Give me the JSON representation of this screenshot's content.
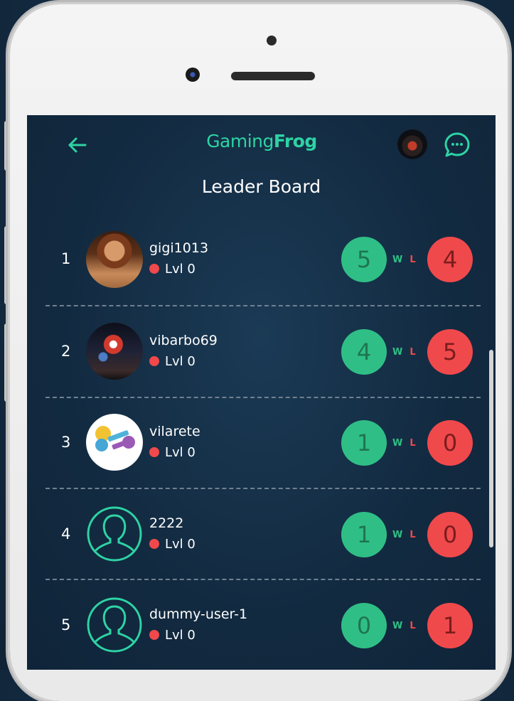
{
  "app": {
    "brand_light": "Gaming",
    "brand_bold": "Frog",
    "title": "Leader Board"
  },
  "icons": {
    "back": "back-arrow-icon",
    "chat": "chat-bubble-icon",
    "default_avatar": "user-outline-icon"
  },
  "colors": {
    "accent": "#2ed3a4",
    "win": "#2fbf86",
    "loss": "#f0494c",
    "background": "#132a40"
  },
  "labels": {
    "win": "W",
    "loss": "L"
  },
  "players": [
    {
      "rank": "1",
      "name": "gigi1013",
      "level": "Lvl 0",
      "wins": "5",
      "losses": "4",
      "avatar": "photo"
    },
    {
      "rank": "2",
      "name": "vibarbo69",
      "level": "Lvl 0",
      "wins": "4",
      "losses": "5",
      "avatar": "photo"
    },
    {
      "rank": "3",
      "name": "vilarete",
      "level": "Lvl 0",
      "wins": "1",
      "losses": "0",
      "avatar": "photo"
    },
    {
      "rank": "4",
      "name": "2222",
      "level": "Lvl 0",
      "wins": "1",
      "losses": "0",
      "avatar": "default"
    },
    {
      "rank": "5",
      "name": "dummy-user-1",
      "level": "Lvl 0",
      "wins": "0",
      "losses": "1",
      "avatar": "default"
    }
  ]
}
